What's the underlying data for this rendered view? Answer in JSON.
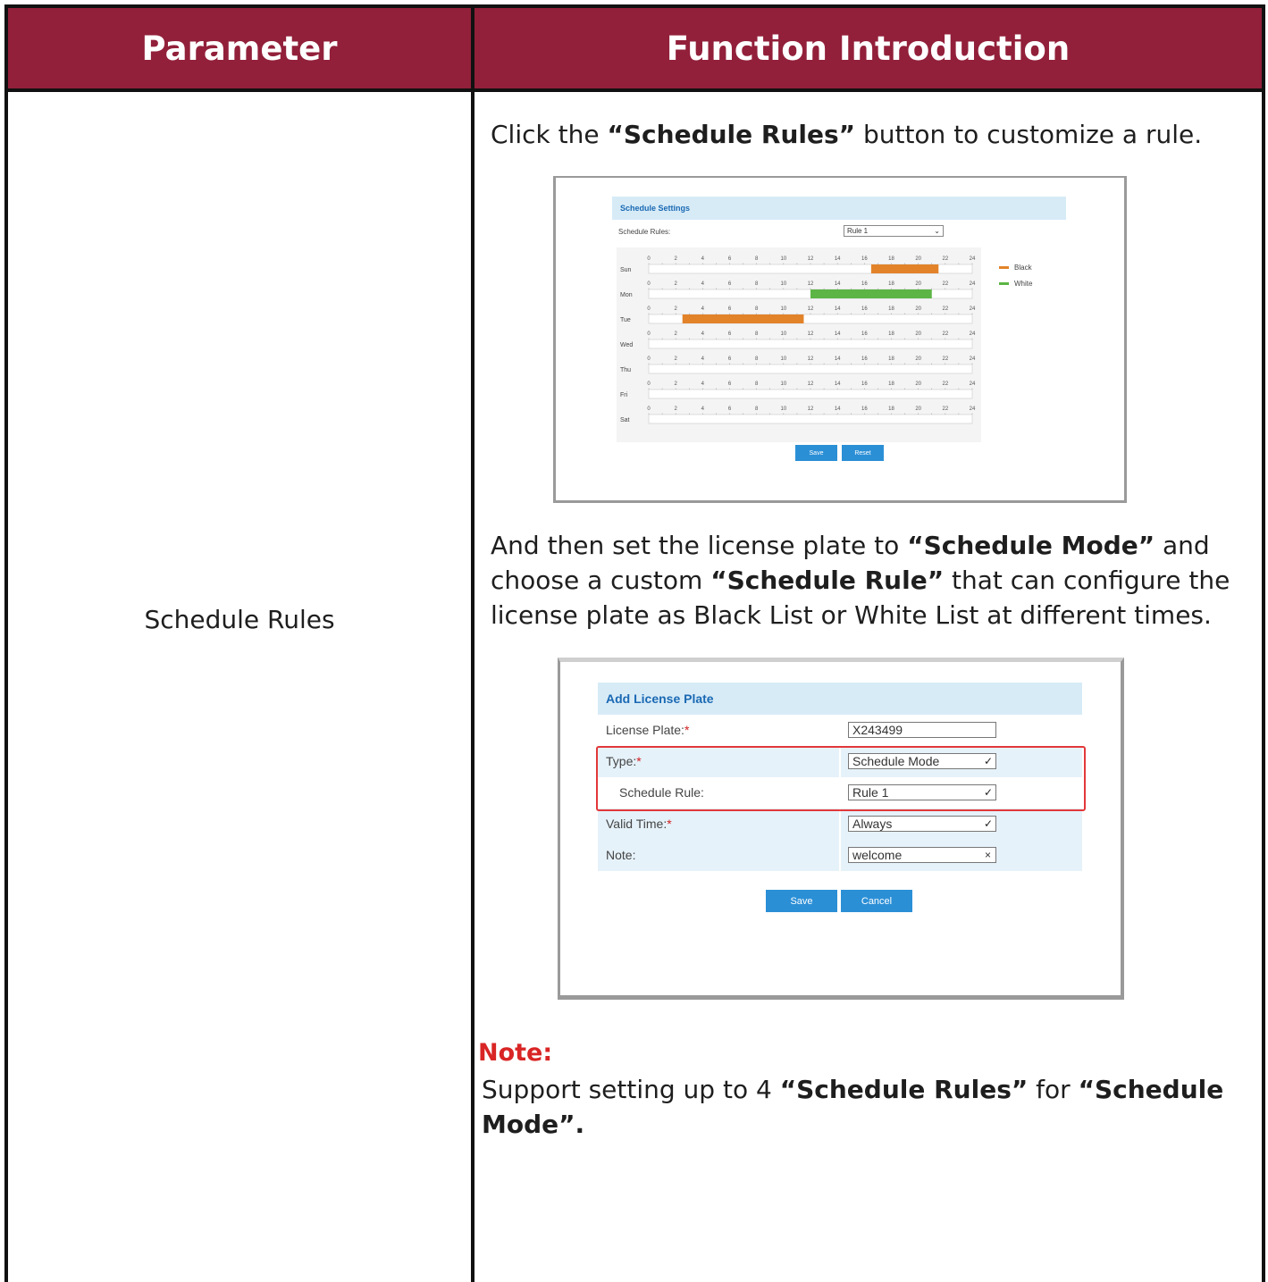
{
  "header": {
    "parameter": "Parameter",
    "function_intro": "Function Introduction"
  },
  "row": {
    "parameter_name": "Schedule Rules",
    "intro_1": {
      "pre": "Click the ",
      "bold": "“Schedule Rules”",
      "post": " button to customize a rule."
    },
    "intro_2": {
      "line1_pre": "And then set the license plate to ",
      "line1_bold": "“Schedule Mode”",
      "line1_post": " and",
      "line2_pre": "choose a custom ",
      "line2_bold": "“Schedule Rule”",
      "line2_post": " that can configure the",
      "line3": "license plate as Black List or White List at different times."
    },
    "note_label": "Note:",
    "note": {
      "pre": "Support setting up to 4 ",
      "bold1": "“Schedule Rules”",
      "mid": " for ",
      "bold2": "“Schedule",
      "line2_bold": "Mode”."
    }
  },
  "schedule_settings": {
    "title": "Schedule Settings",
    "rules_label": "Schedule Rules:",
    "selected_rule": "Rule 1",
    "days": [
      "Sun",
      "Mon",
      "Tue",
      "Wed",
      "Thu",
      "Fri",
      "Sat"
    ],
    "hour_ticks": [
      "0",
      "2",
      "4",
      "6",
      "8",
      "10",
      "12",
      "14",
      "16",
      "18",
      "20",
      "22",
      "24"
    ],
    "blocks": [
      {
        "day": "Sun",
        "start": 16.5,
        "end": 21.5,
        "list": "Black"
      },
      {
        "day": "Mon",
        "start": 12,
        "end": 21,
        "list": "White"
      },
      {
        "day": "Tue",
        "start": 2.5,
        "end": 11.5,
        "list": "Black"
      }
    ],
    "legend": [
      {
        "label": "Black",
        "color": "#e2832a"
      },
      {
        "label": "White",
        "color": "#5cb545"
      }
    ],
    "save": "Save",
    "reset": "Reset"
  },
  "add_license_plate": {
    "title": "Add License Plate",
    "license_label": "License Plate:",
    "license_value": "X243499",
    "type_label": "Type:",
    "type_value": "Schedule Mode",
    "rule_label": "Schedule Rule:",
    "rule_value": "Rule 1",
    "valid_label": "Valid Time:",
    "valid_value": "Always",
    "note_label": "Note:",
    "note_value": "welcome",
    "required_mark": "*",
    "save": "Save",
    "cancel": "Cancel"
  },
  "colors": {
    "header_bg": "#92203a",
    "note_red": "#d92525",
    "accent_blue": "#2b8fd6",
    "black_list": "#e2832a",
    "white_list": "#5cb545"
  }
}
